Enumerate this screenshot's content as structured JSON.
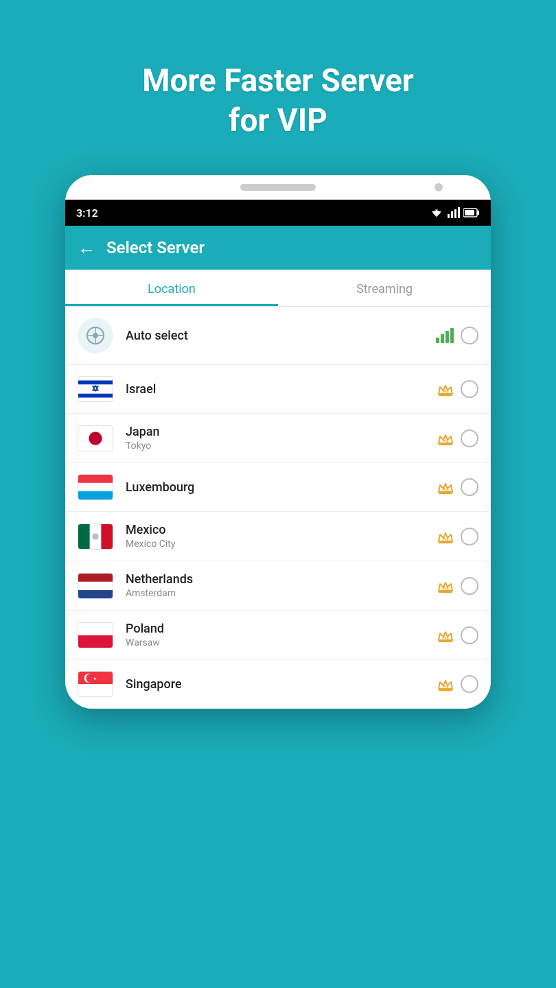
{
  "promo": {
    "line1": "More Faster Server",
    "line2": "for VIP"
  },
  "status_bar": {
    "time": "3:12"
  },
  "header": {
    "title": "Select Server",
    "back_label": "←"
  },
  "tabs": [
    {
      "id": "location",
      "label": "Location",
      "active": true
    },
    {
      "id": "streaming",
      "label": "Streaming",
      "active": false
    }
  ],
  "servers": [
    {
      "id": "auto",
      "name": "Auto select",
      "city": "",
      "type": "auto",
      "badge": "signal"
    },
    {
      "id": "israel",
      "name": "Israel",
      "city": "",
      "type": "israel",
      "badge": "pro"
    },
    {
      "id": "japan",
      "name": "Japan",
      "city": "Tokyo",
      "type": "japan",
      "badge": "pro"
    },
    {
      "id": "luxembourg",
      "name": "Luxembourg",
      "city": "",
      "type": "luxembourg",
      "badge": "pro"
    },
    {
      "id": "mexico",
      "name": "Mexico",
      "city": "Mexico City",
      "type": "mexico",
      "badge": "pro"
    },
    {
      "id": "netherlands",
      "name": "Netherlands",
      "city": "Amsterdam",
      "type": "netherlands",
      "badge": "pro"
    },
    {
      "id": "poland",
      "name": "Poland",
      "city": "Warsaw",
      "type": "poland",
      "badge": "pro"
    },
    {
      "id": "singapore",
      "name": "Singapore",
      "city": "",
      "type": "singapore",
      "badge": "pro"
    }
  ]
}
